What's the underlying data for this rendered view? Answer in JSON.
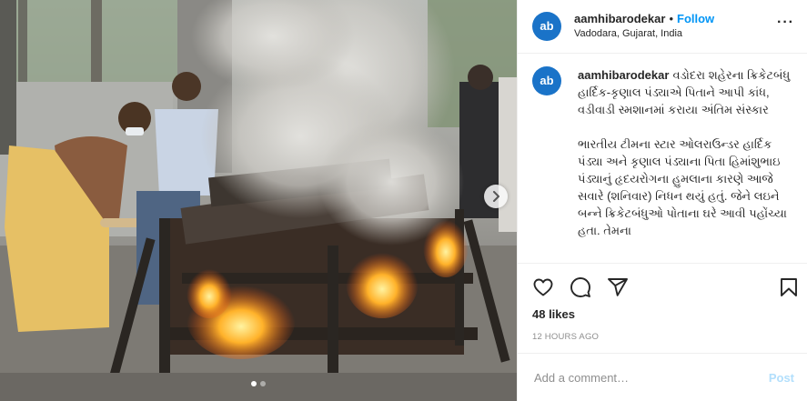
{
  "header": {
    "username": "aamhibarodekar",
    "separator": "•",
    "follow_label": "Follow",
    "location": "Vadodara, Gujarat, India",
    "more_label": "···"
  },
  "caption": {
    "username": "aamhibarodekar",
    "paragraph1": "વડોદરા શહેરના ક્રિકેટબંધુ હાર્દિક-કૃણાલ પંડ્યાએ પિતાને આપી કાંધ, વડીવાડી સ્મશાનમાં કરાયા અંતિમ સંસ્કાર",
    "paragraph2": "ભારતીય ટીમના સ્ટાર ઓલરાઉન્ડર હાર્દિક પંડ્યા અને કૃણાલ પંડ્યાના પિતા હિમાંશુભાઇ પંડ્યાનું હૃદયરોગના હુમલાના કારણે આજે સવારે (શનિવાર) નિધન થયું હતું. જેને લઇને બન્ને ક્રિકેટબંધુઓ પોતાના ઘરે આવી પહોંચ્યા હતા. તેમના"
  },
  "likes": "48 likes",
  "timestamp": "12 HOURS AGO",
  "comment": {
    "placeholder": "Add a comment…",
    "post_label": "Post"
  },
  "carousel": {
    "slide_count": 2,
    "active_index": 0
  },
  "icons": {
    "like": "heart-icon",
    "comment": "speech-bubble-icon",
    "share": "paper-plane-icon",
    "save": "bookmark-icon",
    "next": "chevron-right-icon",
    "avatar": "ab-logo-icon"
  },
  "colors": {
    "accent": "#0095f6",
    "post_disabled": "#b2dffc",
    "text": "#262626",
    "muted": "#8e8e8e",
    "avatar": "#1a73c8"
  }
}
